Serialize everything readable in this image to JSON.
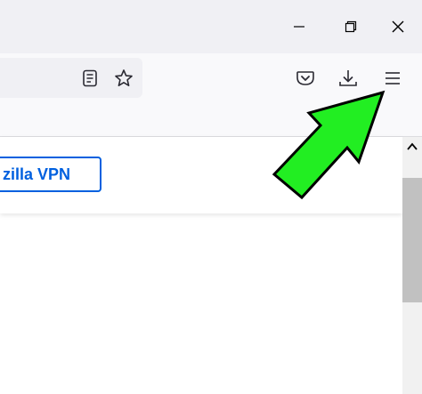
{
  "window": {
    "minimize_icon": "minimize-icon",
    "restore_icon": "restore-icon",
    "close_icon": "close-icon"
  },
  "toolbar": {
    "reader_view_icon": "reader-view-icon",
    "bookmark_star_icon": "bookmark-star-icon",
    "pocket_icon": "pocket-icon",
    "downloads_icon": "download-icon",
    "menu_icon": "hamburger-menu-icon"
  },
  "banner": {
    "vpn_button_label": "zilla VPN"
  },
  "annotation": {
    "arrow_color": "#22ee22",
    "arrow_outline": "#000000"
  },
  "colors": {
    "accent": "#0060df"
  }
}
